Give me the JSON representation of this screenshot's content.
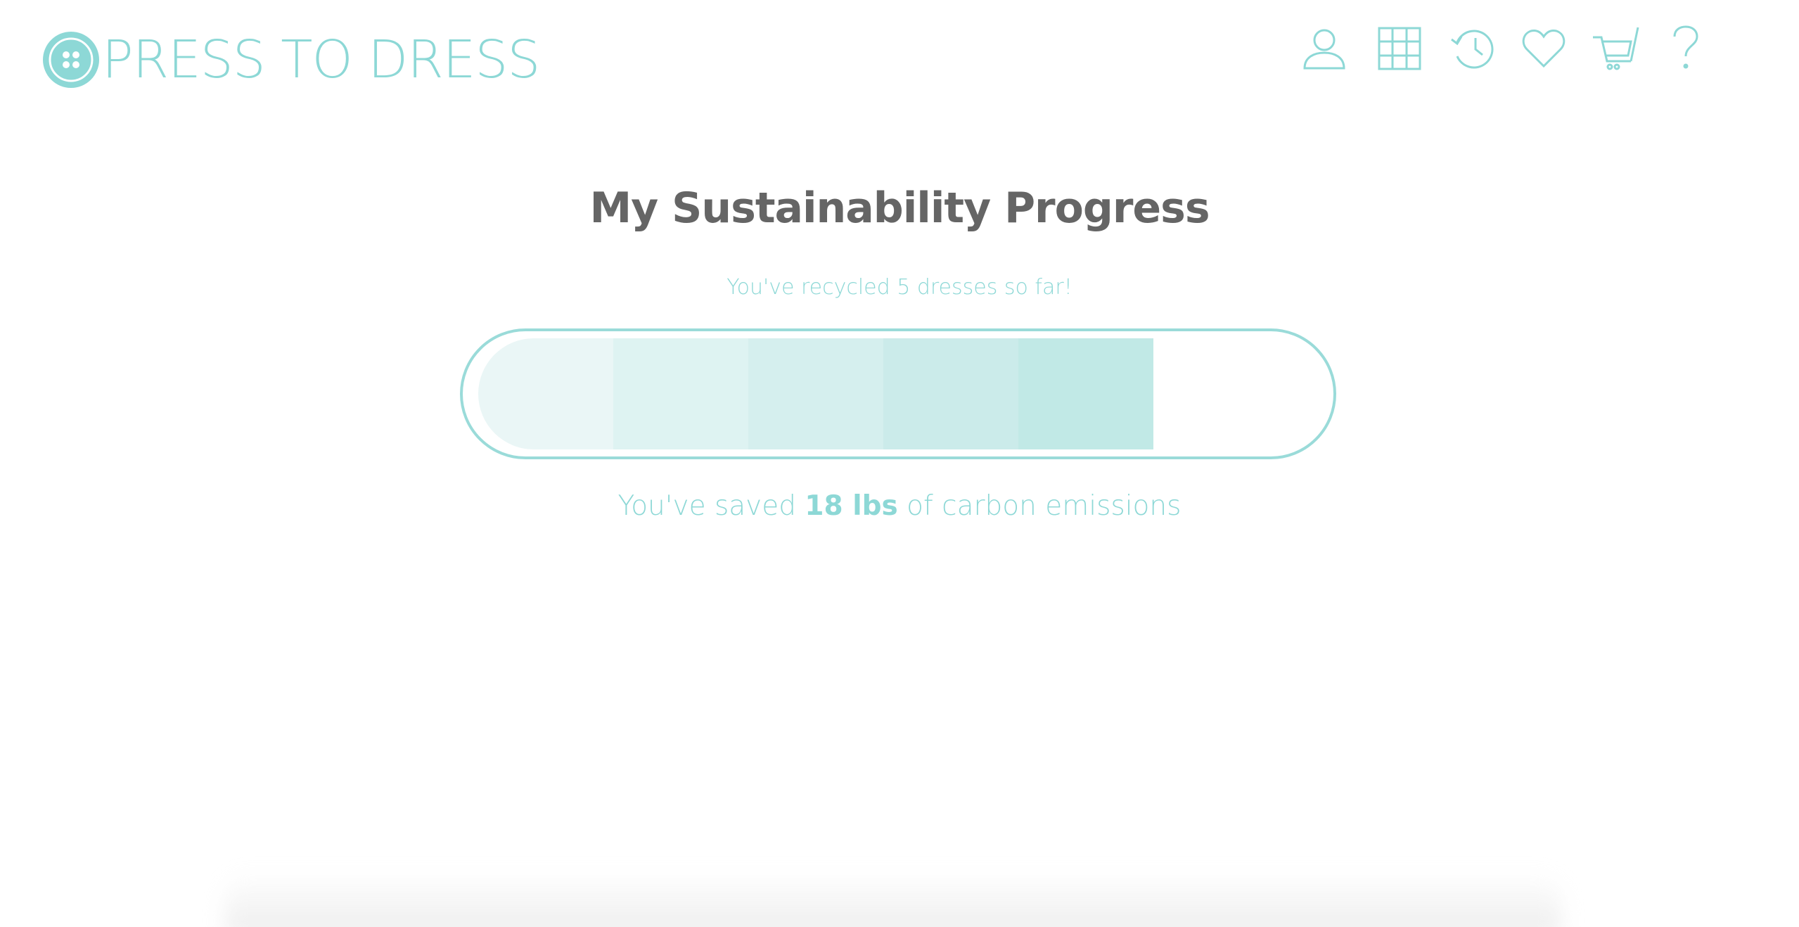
{
  "brand": {
    "name": "PRESS TO DRESS",
    "color": "#8dd8d6"
  },
  "nav": {
    "icons": [
      {
        "name": "user-icon",
        "label": "Account"
      },
      {
        "name": "grid-icon",
        "label": "Browse"
      },
      {
        "name": "history-icon",
        "label": "History"
      },
      {
        "name": "heart-icon",
        "label": "Favorites"
      },
      {
        "name": "cart-icon",
        "label": "Cart"
      },
      {
        "name": "help-icon",
        "label": "Help"
      }
    ],
    "icon_color": "#8dd8d6"
  },
  "main": {
    "title": "My Sustainability Progress",
    "recycled_text": "You've recycled 5 dresses so far!",
    "progress": {
      "filled_segments": 5,
      "segment_colors": [
        "#eaf6f6",
        "#def3f2",
        "#d5efee",
        "#cbebea",
        "#c1e9e6"
      ],
      "border_color": "#9adbd9"
    },
    "saved_prefix": "You've saved ",
    "saved_amount": "18 lbs",
    "saved_suffix": " of carbon emissions"
  },
  "colors": {
    "accent": "#8dd8d6",
    "heading": "#656565"
  }
}
